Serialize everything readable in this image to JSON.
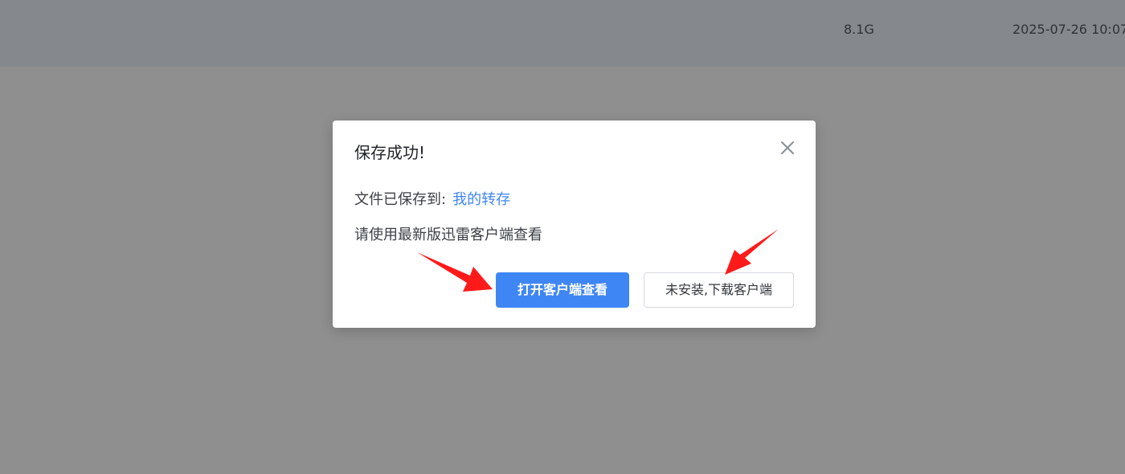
{
  "background_row": {
    "size": "8.1G",
    "date": "2025-07-26 10:07"
  },
  "dialog": {
    "title": "保存成功!",
    "saved_to_label": "文件已保存到:",
    "saved_to_link": "我的转存",
    "hint": "请使用最新版迅雷客户端查看",
    "primary_button": "打开客户端查看",
    "secondary_button": "未安装,下载客户端"
  },
  "colors": {
    "primary": "#3f86f5",
    "annotation_arrow": "#ff1a1a"
  },
  "icons": {
    "close": "close-icon"
  }
}
